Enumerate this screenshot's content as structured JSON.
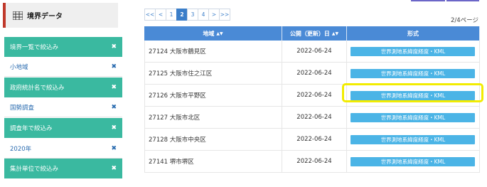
{
  "sidebar": {
    "title": "境界データ",
    "rows": [
      {
        "type": "head",
        "label": "境界一覧で絞込み"
      },
      {
        "type": "item",
        "label": "小地域"
      },
      {
        "type": "head",
        "label": "政府統計名で絞込み"
      },
      {
        "type": "item",
        "label": "国勢調査"
      },
      {
        "type": "head",
        "label": "調査年で絞込み"
      },
      {
        "type": "item",
        "label": "2020年"
      },
      {
        "type": "head",
        "label": "集計単位で絞込み"
      }
    ],
    "remove_glyph": "✖"
  },
  "pagination": {
    "pages": [
      "<<",
      "<",
      "1",
      "2",
      "3",
      "4",
      ">",
      ">>"
    ],
    "active": "2",
    "page_count": "2/4ページ"
  },
  "table": {
    "headers": {
      "area": "地域",
      "published": "公開（更新）日",
      "format": "形式"
    },
    "rows": [
      {
        "area": "27124 大阪市鶴見区",
        "date": "2022-06-24",
        "format": "世界測地系緯度経度・KML"
      },
      {
        "area": "27125 大阪市住之江区",
        "date": "2022-06-24",
        "format": "世界測地系緯度経度・KML"
      },
      {
        "area": "27126 大阪市平野区",
        "date": "2022-06-24",
        "format": "世界測地系緯度経度・KML"
      },
      {
        "area": "27127 大阪市北区",
        "date": "2022-06-24",
        "format": "世界測地系緯度経度・KML"
      },
      {
        "area": "27128 大阪市中央区",
        "date": "2022-06-24",
        "format": "世界測地系緯度経度・KML"
      },
      {
        "area": "27141 堺市堺区",
        "date": "2022-06-24",
        "format": "世界測地系緯度経度・KML"
      }
    ]
  },
  "colors": {
    "accent": "#3ab9a0",
    "table_header": "#4a8ad6",
    "button": "#4bb4e6",
    "highlight": "#f2ec00"
  }
}
